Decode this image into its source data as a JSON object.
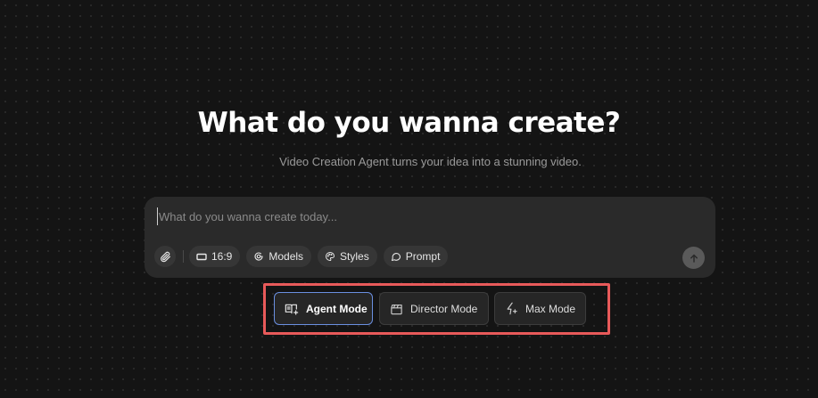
{
  "headline": "What do you wanna create?",
  "subtitle": "Video Creation Agent turns your idea into a stunning video.",
  "composer": {
    "placeholder": "What do you wanna create today...",
    "toolbar": {
      "attach_icon": "paperclip-icon",
      "aspect_ratio": "16:9",
      "models_label": "Models",
      "styles_label": "Styles",
      "prompt_label": "Prompt"
    },
    "send_icon": "arrow-up-icon"
  },
  "modes": [
    {
      "label": "Agent Mode",
      "icon": "agent-book-icon",
      "active": true
    },
    {
      "label": "Director Mode",
      "icon": "clapperboard-icon",
      "active": false
    },
    {
      "label": "Max Mode",
      "icon": "sparkle-bolt-icon",
      "active": false
    }
  ],
  "colors": {
    "background": "#141414",
    "composer_bg": "#2a2a2a",
    "pill_bg": "#363636",
    "active_border": "#6a8fe0",
    "highlight": "#e85a5a"
  }
}
